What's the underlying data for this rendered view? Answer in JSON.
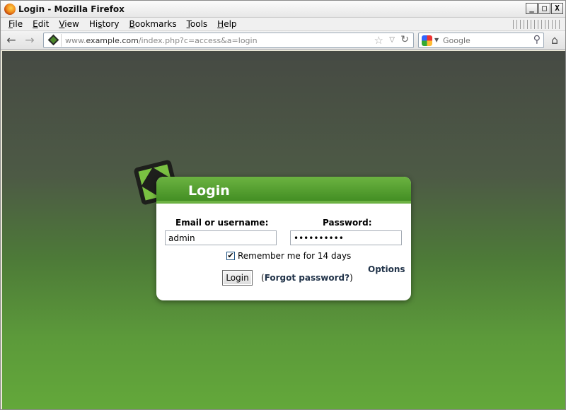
{
  "window": {
    "title": "Login - Mozilla Firefox",
    "controls": {
      "minimize": "_",
      "maximize": "□",
      "close": "X"
    }
  },
  "menu": [
    {
      "label": "File",
      "accel": "F",
      "rest": "ile"
    },
    {
      "label": "Edit",
      "accel": "E",
      "rest": "dit"
    },
    {
      "label": "View",
      "accel": "V",
      "rest": "iew"
    },
    {
      "label": "History",
      "accel": "",
      "pre": "Hi",
      "accel2": "s",
      "post": "tory"
    },
    {
      "label": "Bookmarks",
      "accel": "B",
      "rest": "ookmarks"
    },
    {
      "label": "Tools",
      "accel": "T",
      "rest": "ools"
    },
    {
      "label": "Help",
      "accel": "H",
      "rest": "elp"
    }
  ],
  "navigation": {
    "url_prefix": "www.",
    "url_host": "example.com",
    "url_path": "/index.php?c=access&a=login",
    "search_placeholder": "Google",
    "icons": {
      "back": "←",
      "forward": "→",
      "star": "☆",
      "dropdown": "▽",
      "reload": "↻",
      "search": "⚲",
      "home": "⌂",
      "search_dropdown": "▼"
    }
  },
  "login": {
    "title": "Login",
    "username_label": "Email or username:",
    "username_value": "admin",
    "password_label": "Password:",
    "password_value": "••••••••••",
    "remember_label": "Remember me for 14 days",
    "remember_checked": true,
    "login_button": "Login",
    "forgot_open": "(",
    "forgot_link": "Forgot password?",
    "forgot_close": ")",
    "options_link": "Options",
    "brand_colors": {
      "header_top": "#6cb341",
      "header_bottom": "#3e8a20",
      "link": "#22344a"
    }
  }
}
